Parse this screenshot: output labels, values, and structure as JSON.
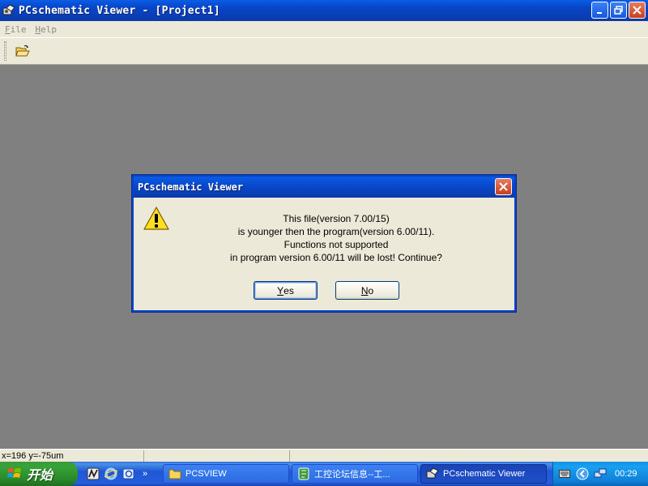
{
  "window": {
    "title": "PCschematic Viewer - [Project1]"
  },
  "menu": {
    "items": [
      {
        "label": "File",
        "mnemonic": "F",
        "rest": "ile"
      },
      {
        "label": "Help",
        "mnemonic": "H",
        "rest": "elp"
      }
    ]
  },
  "toolbar": {
    "open_icon": "open-folder-icon"
  },
  "dialog": {
    "title": "PCschematic Viewer",
    "icon": "warning-icon",
    "message": [
      "This file(version 7.00/15)",
      "is younger then the program(version 6.00/11).",
      "Functions not supported",
      "in program version 6.00/11 will be lost! Continue?"
    ],
    "yes": {
      "mnemonic": "Y",
      "rest": "es"
    },
    "no": {
      "mnemonic": "N",
      "rest": "o"
    }
  },
  "statusbar": {
    "coords": "x=196 y=-75um"
  },
  "taskbar": {
    "start_label": "开始",
    "tasks": [
      {
        "label": "PCSVIEW",
        "icon": "folder-icon"
      },
      {
        "label": "工控论坛信息--工...",
        "icon": "browser-icon"
      },
      {
        "label": "PCschematic Viewer",
        "icon": "pcschematic-icon",
        "active": true
      }
    ],
    "clock": "00:29",
    "colors": {
      "start": "#37a337",
      "bar": "#245edc",
      "tray": "#0d80d8"
    }
  }
}
